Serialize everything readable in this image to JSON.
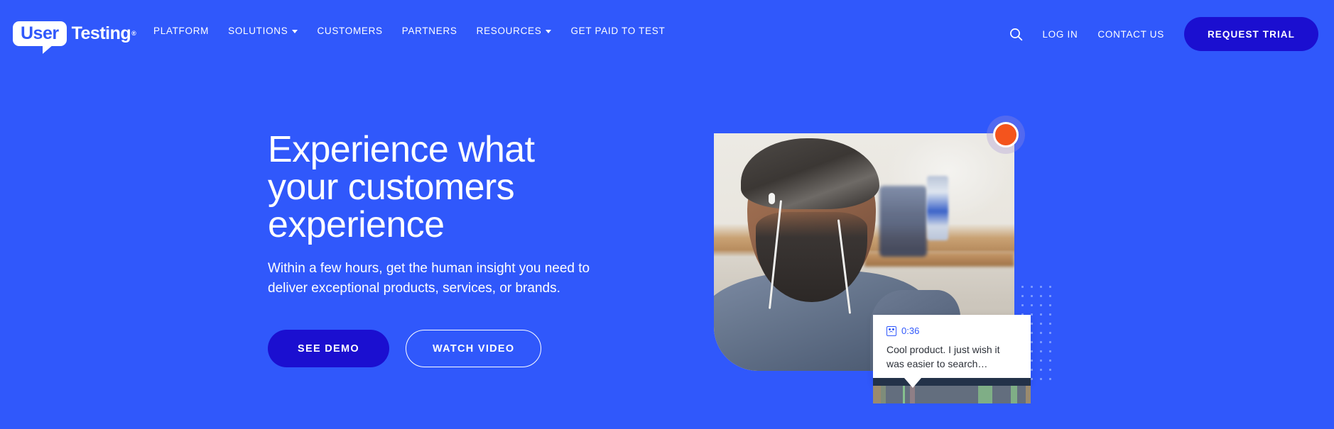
{
  "theme": {
    "background": "#3058fb",
    "accent_dark_blue": "#1b0fd0",
    "record_orange": "#f4541d",
    "white": "#ffffff",
    "dot_pattern": "#7e9bff",
    "timeline_dark": "#233249"
  },
  "header": {
    "logo": {
      "bubble_text": "User",
      "word": "Testing",
      "trademark": "®"
    },
    "nav": [
      {
        "label": "PLATFORM",
        "has_caret": false
      },
      {
        "label": "SOLUTIONS",
        "has_caret": true
      },
      {
        "label": "CUSTOMERS",
        "has_caret": false
      },
      {
        "label": "PARTNERS",
        "has_caret": false
      },
      {
        "label": "RESOURCES",
        "has_caret": true
      },
      {
        "label": "GET PAID TO TEST",
        "has_caret": false
      }
    ],
    "search_icon": "search-icon",
    "login_label": "LOG IN",
    "contact_label": "CONTACT US",
    "trial_label": "REQUEST TRIAL"
  },
  "hero": {
    "title_line_1": "Experience what",
    "title_line_2": "your customers",
    "title_line_3": "experience",
    "subtitle": "Within a few hours, get the human insight you need to deliver exceptional products, services, or brands.",
    "primary_cta": "SEE DEMO",
    "secondary_cta": "WATCH VIDEO"
  },
  "media": {
    "record_indicator": "record-dot",
    "annotation": {
      "icon": "sentiment-frame-icon",
      "timestamp": "0:36",
      "quote": "Cool product. I just wish it was easier to search…"
    },
    "timeline_segments": [
      {
        "color": "#9a8a6e",
        "width": "5%"
      },
      {
        "color": "#7e8c7a",
        "width": "3%"
      },
      {
        "color": "#636e7e",
        "width": "11%"
      },
      {
        "color": "#86c08e",
        "width": "1.5%"
      },
      {
        "color": "#636e7e",
        "width": "3%"
      },
      {
        "color": "#8f7f86",
        "width": "3%"
      },
      {
        "color": "#636e7e",
        "width": "40%"
      },
      {
        "color": "#7fae86",
        "width": "9%"
      },
      {
        "color": "#636e7e",
        "width": "12%"
      },
      {
        "color": "#7fae86",
        "width": "4%"
      },
      {
        "color": "#636e7e",
        "width": "5.5%"
      },
      {
        "color": "#9a8a6e",
        "width": "3%"
      }
    ]
  }
}
